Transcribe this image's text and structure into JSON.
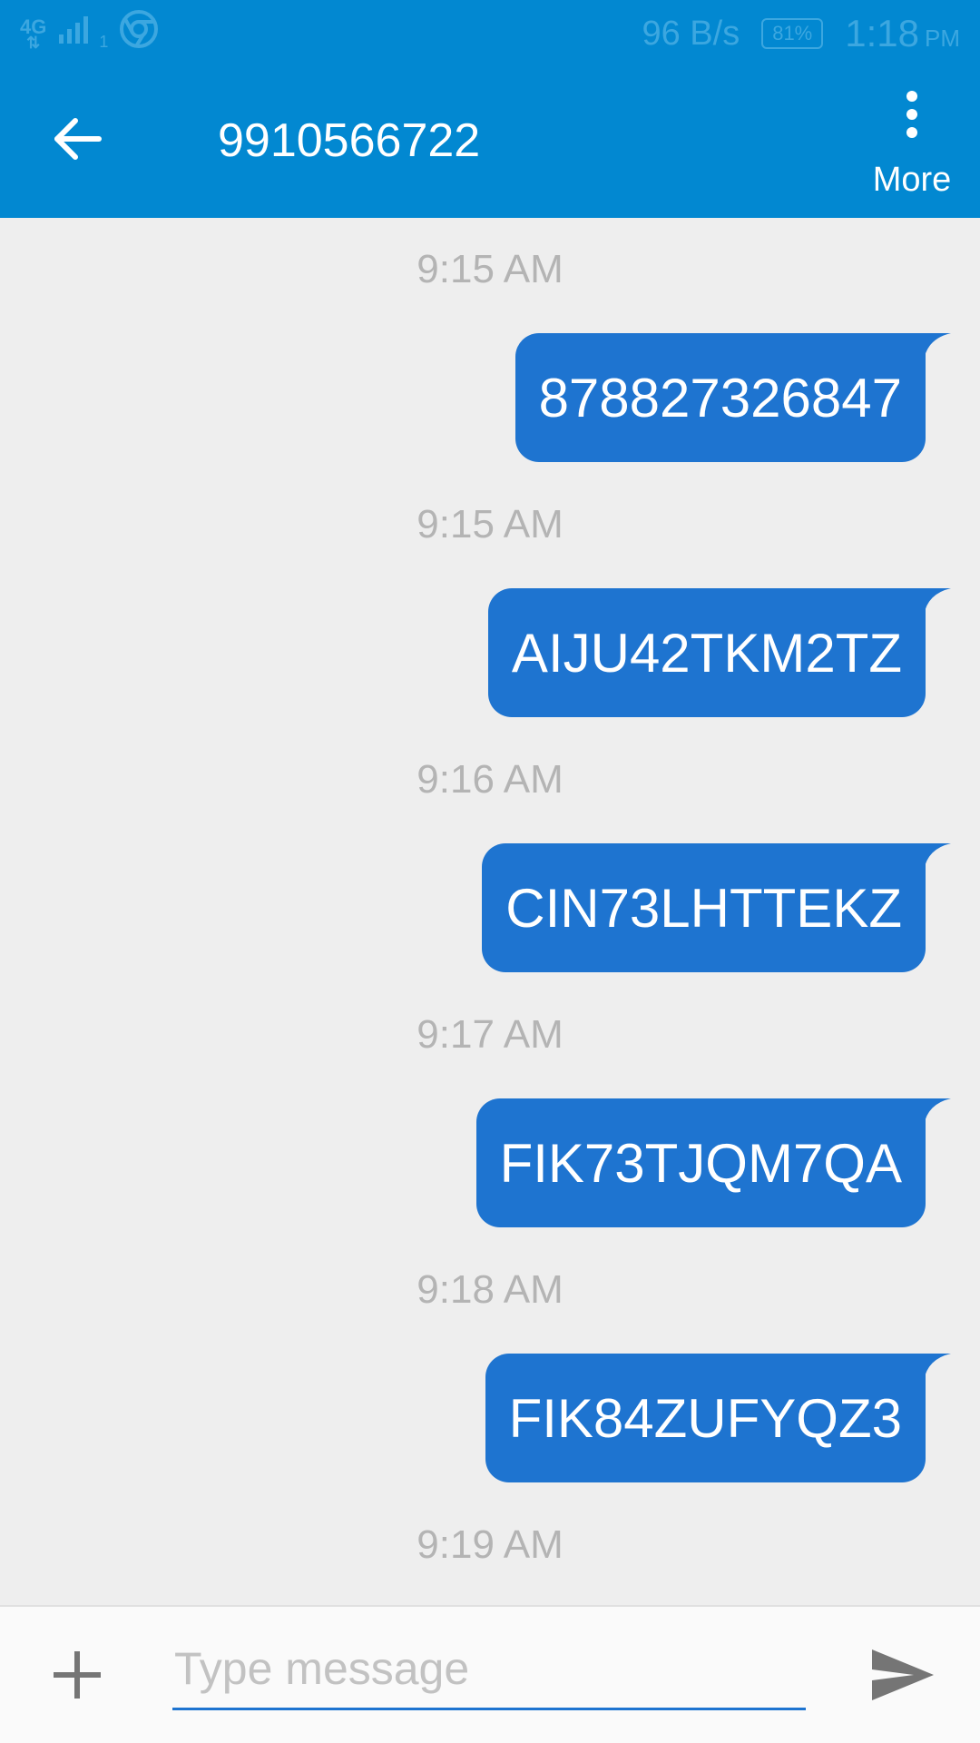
{
  "status_bar": {
    "network_type": "4G",
    "sim_slot": "1",
    "net_speed": "96 B/s",
    "battery": "81%",
    "time": "1:18",
    "ampm": "PM",
    "icons": [
      "signal-icon",
      "chrome-icon",
      "battery-icon"
    ]
  },
  "app_bar": {
    "title": "9910566722",
    "more_label": "More",
    "icons": [
      "back-arrow-icon",
      "more-vert-icon"
    ]
  },
  "conversation": {
    "timestamps": [
      "9:15 AM",
      "9:15 AM",
      "9:16 AM",
      "9:17 AM",
      "9:18 AM",
      "9:19 AM"
    ],
    "messages": [
      {
        "text": "878827326847",
        "direction": "outgoing"
      },
      {
        "text": "AIJU42TKM2TZ",
        "direction": "outgoing"
      },
      {
        "text": "CIN73LHTTEKZ",
        "direction": "outgoing"
      },
      {
        "text": "FIK73TJQM7QA",
        "direction": "outgoing"
      },
      {
        "text": "FIK84ZUFYQZ3",
        "direction": "outgoing"
      }
    ]
  },
  "composer": {
    "placeholder": "Type message",
    "value": "",
    "icons": [
      "add-icon",
      "send-icon"
    ]
  },
  "colors": {
    "app_bar": "#0288d1",
    "bubble": "#1e74d0",
    "background": "#eeeeee",
    "timestamp": "#b4b4b4"
  }
}
